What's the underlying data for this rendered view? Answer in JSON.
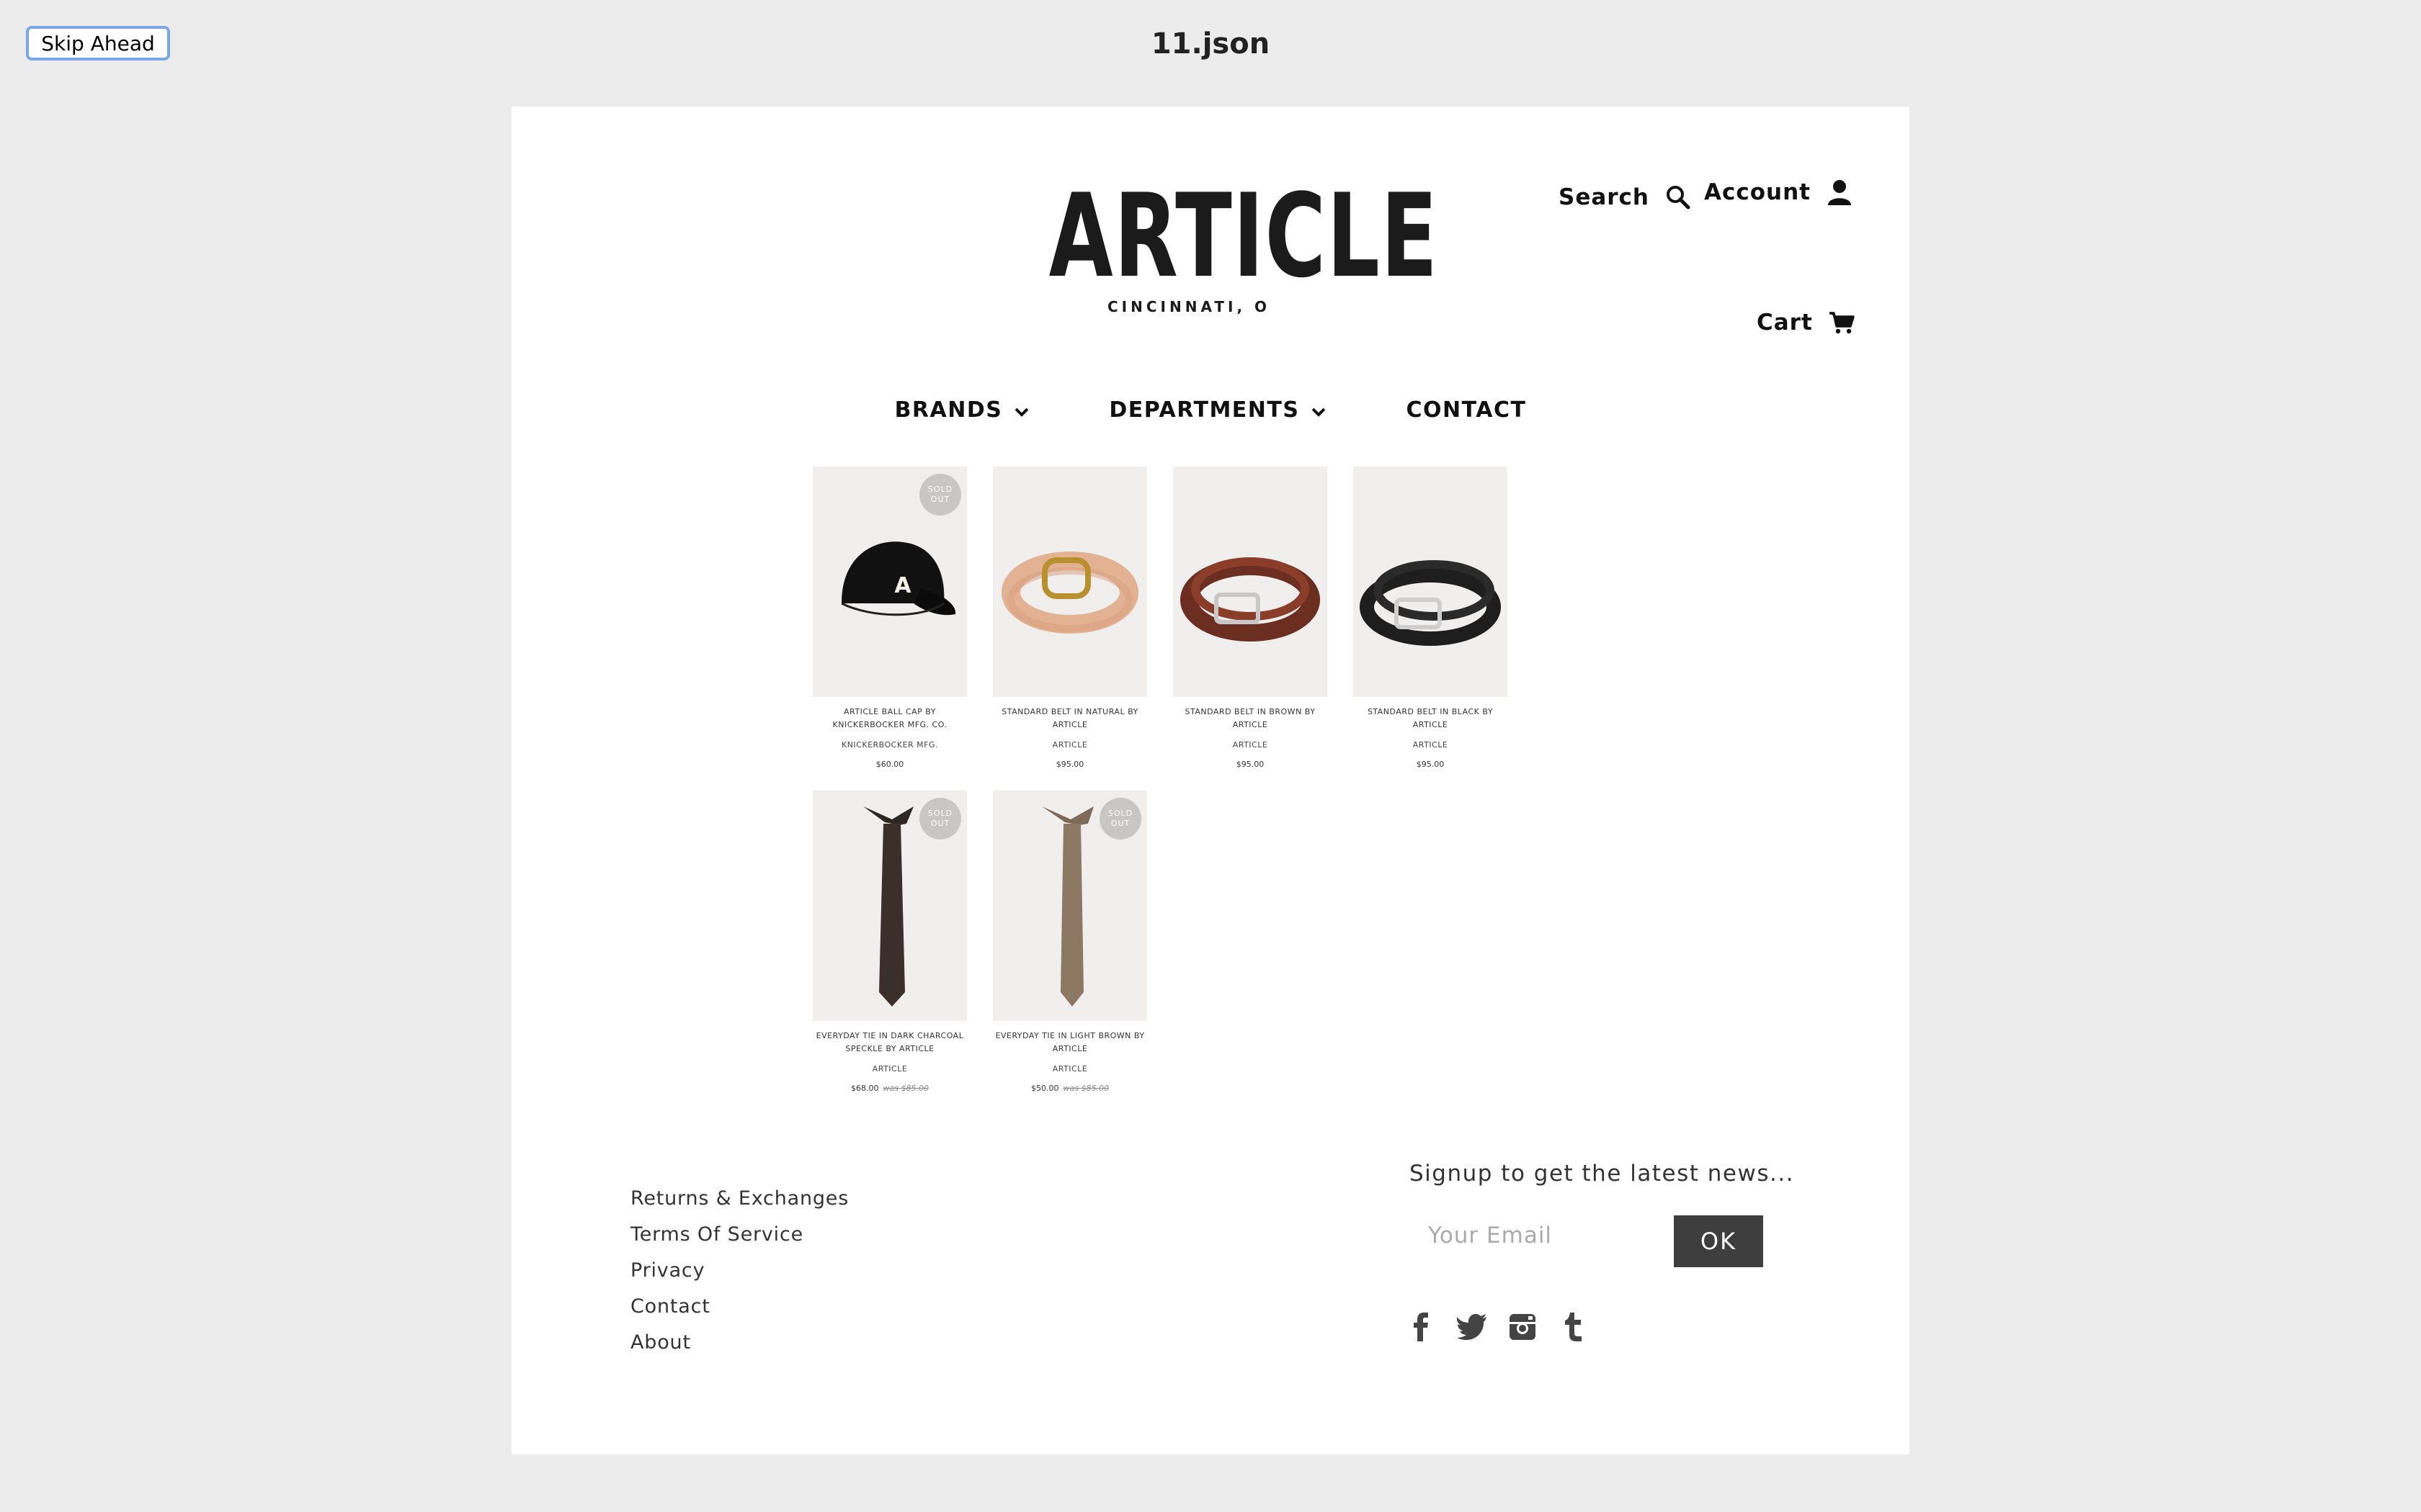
{
  "chrome": {
    "skip_label": "Skip Ahead",
    "doc_title": "11.json"
  },
  "header": {
    "logo_word": "ARTICLE",
    "logo_sub": "CINCINNATI, O",
    "search_label": "Search",
    "account_label": "Account",
    "cart_label": "Cart"
  },
  "nav": {
    "items": [
      {
        "label": "BRANDS",
        "has_dropdown": true
      },
      {
        "label": "DEPARTMENTS",
        "has_dropdown": true
      },
      {
        "label": "CONTACT",
        "has_dropdown": false
      }
    ]
  },
  "products": [
    {
      "title": "ARTICLE BALL CAP BY KNICKERBOCKER MFG. CO.",
      "vendor": "KNICKERBOCKER MFG.",
      "price": "$60.00",
      "was": "",
      "sold_out": "SOLD OUT",
      "image": "black-cap"
    },
    {
      "title": "STANDARD BELT IN NATURAL BY ARTICLE",
      "vendor": "ARTICLE",
      "price": "$95.00",
      "was": "",
      "sold_out": "",
      "image": "natural-belt"
    },
    {
      "title": "STANDARD BELT IN BROWN BY ARTICLE",
      "vendor": "ARTICLE",
      "price": "$95.00",
      "was": "",
      "sold_out": "",
      "image": "brown-belt"
    },
    {
      "title": "STANDARD BELT IN BLACK BY ARTICLE",
      "vendor": "ARTICLE",
      "price": "$95.00",
      "was": "",
      "sold_out": "",
      "image": "black-belt"
    },
    {
      "title": "EVERYDAY TIE IN DARK CHARCOAL SPECKLE BY ARTICLE",
      "vendor": "ARTICLE",
      "price": "$68.00",
      "was": "was $85.00",
      "sold_out": "SOLD OUT",
      "image": "charcoal-tie"
    },
    {
      "title": "EVERYDAY TIE IN LIGHT BROWN BY ARTICLE",
      "vendor": "ARTICLE",
      "price": "$50.00",
      "was": "was $85.00",
      "sold_out": "SOLD OUT",
      "image": "brown-tie"
    }
  ],
  "footer": {
    "links": [
      "Returns & Exchanges",
      "Terms Of Service",
      "Privacy",
      "Contact",
      "About"
    ],
    "signup_title": "Signup to get the latest news...",
    "email_placeholder": "Your Email",
    "ok_label": "OK",
    "social": [
      "facebook-icon",
      "twitter-icon",
      "instagram-icon",
      "tumblr-icon"
    ]
  },
  "colors": {
    "page_bg": "#ececec",
    "card_bg": "#ffffff",
    "ok_button": "#3e3e3e",
    "sold_badge": "#c9c6c6"
  }
}
